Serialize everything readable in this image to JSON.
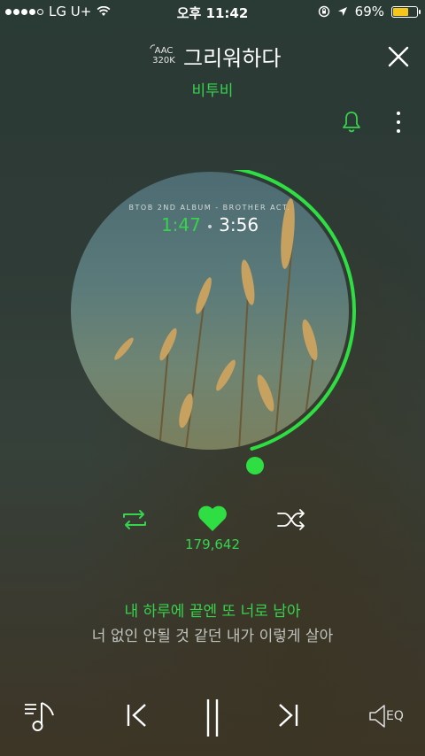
{
  "status_bar": {
    "carrier": "LG U+",
    "time": "오후 11:42",
    "battery": "69%",
    "battery_level": 0.69
  },
  "header": {
    "quality_format": "AAC",
    "quality_bitrate": "320K",
    "title": "그리워하다",
    "artist": "비투비"
  },
  "player": {
    "album_caption": "BTOB 2ND ALBUM - BROTHER ACT.",
    "current_time": "1:47",
    "total_time": "3:56",
    "separator": "•",
    "progress": 0.453
  },
  "actions": {
    "like_count": "179,642"
  },
  "lyrics": {
    "current": "내 하루에 끝엔 또 너로 남아",
    "next": "너 없인 안될 것 같던 내가 이렇게 살아"
  },
  "bottom_bar": {
    "eq_label": "EQ"
  },
  "colors": {
    "accent": "#36d34c",
    "battery": "#f7c61a"
  }
}
